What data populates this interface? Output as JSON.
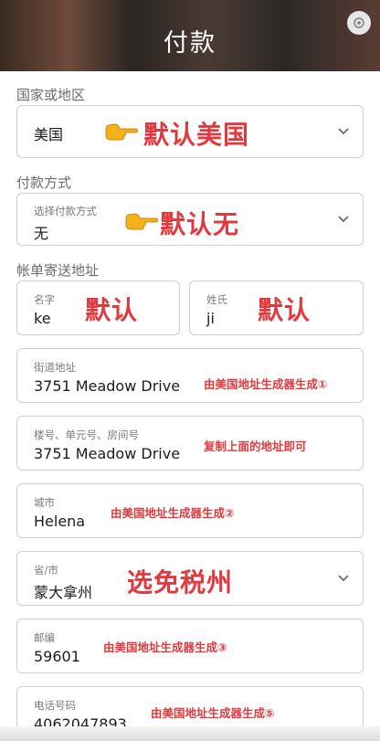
{
  "header": {
    "title": "付款"
  },
  "sections": {
    "country_label": "国家或地区",
    "payment_label": "付款方式",
    "billing_label": "帐单寄送地址"
  },
  "country": {
    "value": "美国",
    "annotation": "默认美国"
  },
  "payment": {
    "label": "选择付款方式",
    "value": "无",
    "annotation": "默认无"
  },
  "first_name": {
    "label": "名字",
    "value": "ke",
    "annotation": "默认"
  },
  "last_name": {
    "label": "姓氏",
    "value": "ji",
    "annotation": "默认"
  },
  "street": {
    "label": "街道地址",
    "value": "3751  Meadow Drive",
    "annotation": "由美国地址生成器生成①"
  },
  "unit": {
    "label": "楼号、单元号、房间号",
    "value": "3751  Meadow Drive",
    "annotation": "复制上面的地址即可"
  },
  "city": {
    "label": "城市",
    "value": "Helena",
    "annotation": "由美国地址生成器生成②"
  },
  "state": {
    "label": "省/市",
    "value": "蒙大拿州",
    "annotation": "选免税州"
  },
  "zip": {
    "label": "邮编",
    "value": "59601",
    "annotation": "由美国地址生成器生成③"
  },
  "phone": {
    "label": "电话号码",
    "value": "4062047893",
    "annotation": "由美国地址生成器生成⑤"
  },
  "icons": {
    "chevron": "chevron-down-icon",
    "hand": "pointing-hand-icon",
    "corner": "app-clip-icon"
  },
  "colors": {
    "annotation": "#e03a3e",
    "hand": "#f5b11c",
    "border": "#cfcfd4"
  }
}
